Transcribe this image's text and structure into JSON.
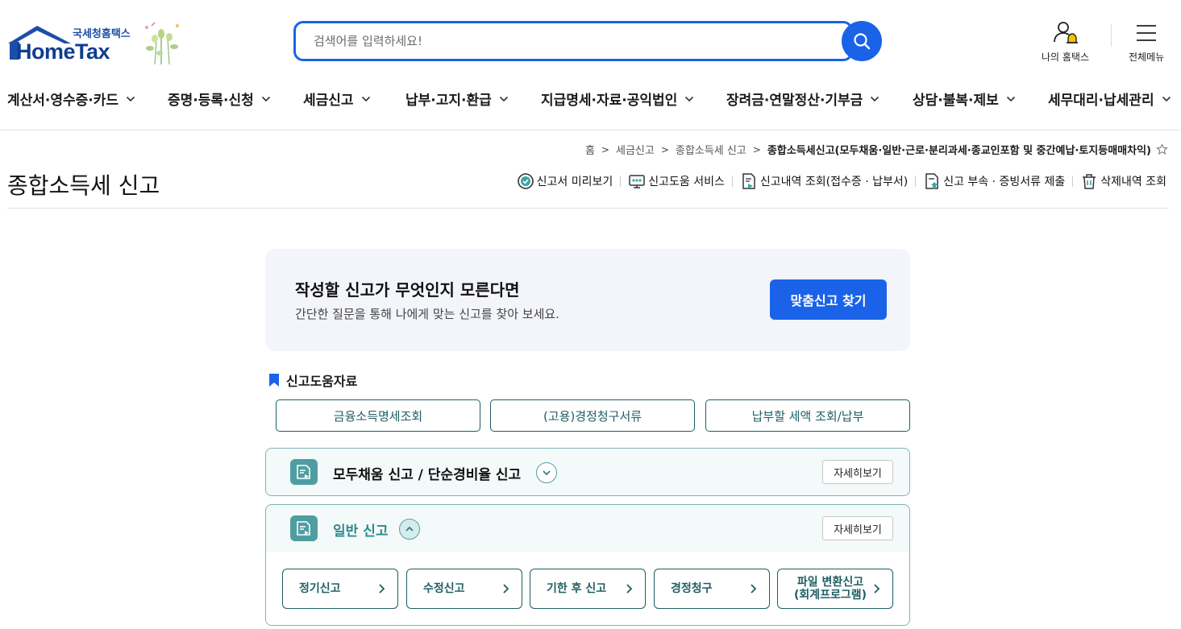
{
  "header": {
    "logo_sub": "국세청홈택스",
    "logo_main": "HomeTax",
    "search": {
      "placeholder": "검색어를 입력하세요!"
    },
    "my_hometax_label": "나의 홈택스",
    "all_menu_label": "전체메뉴"
  },
  "gnb": [
    {
      "label": "계산서·영수증·카드"
    },
    {
      "label": "증명·등록·신청"
    },
    {
      "label": "세금신고"
    },
    {
      "label": "납부·고지·환급"
    },
    {
      "label": "지급명세·자료·공익법인"
    },
    {
      "label": "장려금·연말정산·기부금"
    },
    {
      "label": "상담·불복·제보"
    },
    {
      "label": "세무대리·납세관리"
    }
  ],
  "breadcrumb": [
    "홈",
    "세금신고",
    "종합소득세 신고",
    "종합소득세신고(모두채움·일반·근로·분리과세·종교인포함 및 중간예납·토지등매매차익)"
  ],
  "page_title": "종합소득세 신고",
  "quick_links": [
    {
      "label": "신고서 미리보기",
      "icon": "check-circle-icon"
    },
    {
      "label": "신고도움 서비스",
      "icon": "monitor-help-icon"
    },
    {
      "label": "신고내역 조회(접수증 · 납부서)",
      "icon": "document-search-icon"
    },
    {
      "label": "신고 부속 · 증빙서류 제출",
      "icon": "document-upload-icon"
    },
    {
      "label": "삭제내역 조회",
      "icon": "trash-icon"
    }
  ],
  "guide": {
    "heading": "작성할 신고가 무엇인지 모른다면",
    "desc": "간단한 질문을 통해 나에게 맞는 신고를 찾아 보세요.",
    "button": "맞춤신고 찾기"
  },
  "help": {
    "title": "신고도움자료",
    "buttons": [
      "금융소득명세조회",
      "(고용)경정청구서류",
      "납부할 세액 조회/납부"
    ]
  },
  "accordions": [
    {
      "title": "모두채움 신고 / 단순경비율 신고",
      "detail": "자세히보기",
      "expanded": false
    },
    {
      "title": "일반 신고",
      "detail": "자세히보기",
      "expanded": true,
      "options": [
        {
          "label": "정기신고"
        },
        {
          "label": "수정신고"
        },
        {
          "label": "기한 후 신고"
        },
        {
          "label": "경정청구"
        },
        {
          "label_line1": "파일 변환신고",
          "label_line2": "(회계프로그램)"
        }
      ]
    }
  ],
  "colors": {
    "primary": "#1a63e8",
    "logo_navy": "#0f3d8f",
    "teal": "#1f5e63",
    "teal_icon": "#4e9ea1",
    "guide_bg": "#f3f5fb"
  }
}
